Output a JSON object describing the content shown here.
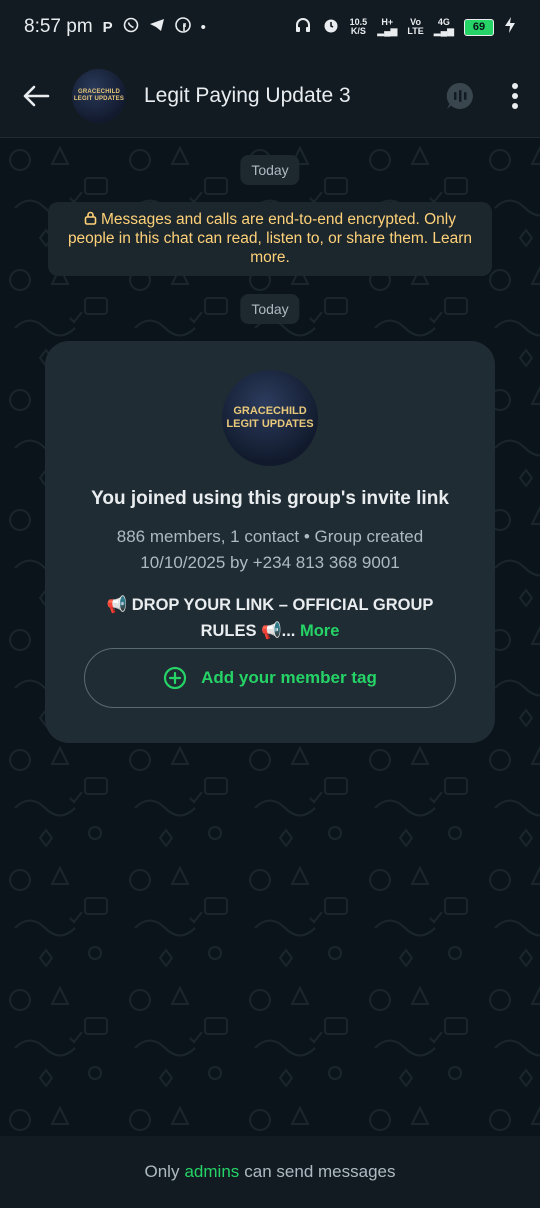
{
  "status_bar": {
    "time": "8:57 pm",
    "net_speed_top": "10.5",
    "net_speed_bottom": "K/S",
    "signal_1": "H+",
    "signal_2_top": "Vo",
    "signal_2_bottom": "LTE",
    "signal_3": "4G",
    "battery": "69",
    "left_icons": [
      "parking-icon",
      "whatsapp-icon",
      "telegram-icon",
      "facebook-icon",
      "dot-icon"
    ],
    "right_icons": [
      "headphones-icon",
      "alarm-icon",
      "charging-icon"
    ]
  },
  "header": {
    "title": "Legit Paying Update 3",
    "avatar_text_line1": "GRACECHILD",
    "avatar_text_line2": "LEGIT UPDATES"
  },
  "chat": {
    "date_chip_1": "Today",
    "encryption_notice": "Messages and calls are end-to-end encrypted. Only people in this chat can read, listen to, or share them. Learn more.",
    "date_chip_2": "Today",
    "group_card": {
      "avatar_text_line1": "GRACECHILD",
      "avatar_text_line2": "LEGIT UPDATES",
      "title": "You joined using this group's invite link",
      "meta": "886 members, 1 contact • Group created 10/10/2025 by +234 813 368 9001",
      "description": "📢 DROP YOUR LINK – OFFICIAL GROUP RULES 📢...",
      "more_label": "More",
      "tag_button_label": "Add your member tag"
    }
  },
  "footer": {
    "prefix": "Only",
    "link": "admins",
    "suffix": "can send messages"
  },
  "colors": {
    "accent": "#25d366",
    "background": "#0b141a",
    "bar": "#121b22",
    "card": "#1f2c33",
    "encryption_text": "#ffd279"
  }
}
